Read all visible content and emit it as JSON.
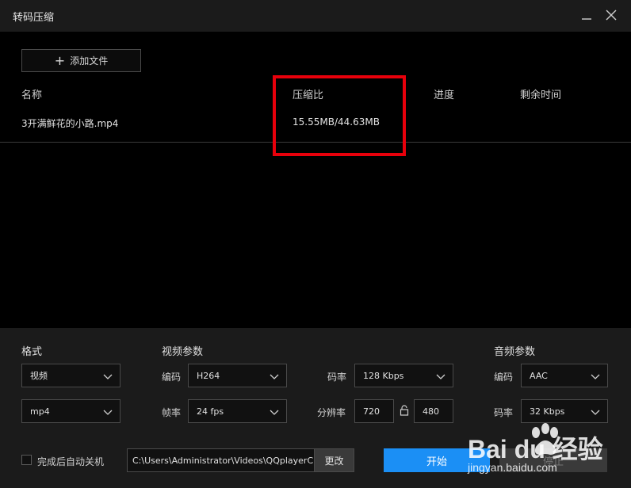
{
  "window": {
    "title": "转码压缩"
  },
  "toolbar": {
    "add_file_label": "添加文件"
  },
  "file_table": {
    "columns": [
      "名称",
      "压缩比",
      "进度",
      "剩余时间"
    ],
    "rows": [
      {
        "name": "3开满鲜花的小路.mp4",
        "ratio": "15.55MB/44.63MB",
        "progress": "",
        "remaining": ""
      }
    ]
  },
  "annotation": {
    "highlight_color": "#e8000b"
  },
  "settings": {
    "format": {
      "title": "格式",
      "type_value": "视频",
      "container_value": "mp4"
    },
    "video": {
      "title": "视频参数",
      "codec_label": "编码",
      "codec_value": "H264",
      "fps_label": "帧率",
      "fps_value": "24 fps",
      "bitrate_label": "码率",
      "bitrate_value": "128 Kbps",
      "resolution_label": "分辨率",
      "width_value": "720",
      "height_value": "480"
    },
    "audio": {
      "title": "音频参数",
      "codec_label": "编码",
      "codec_value": "AAC",
      "bitrate_label": "码率",
      "bitrate_value": "32 Kbps"
    }
  },
  "footer": {
    "auto_shutdown_label": "完成后自动关机",
    "auto_shutdown_checked": false,
    "output_path": "C:\\Users\\Administrator\\Videos\\QQplayerC",
    "change_label": "更改",
    "start_label": "开始",
    "stop_label": "停止"
  },
  "theme": {
    "accent": "#1b8ff5",
    "panel_bg": "#1b1b1b",
    "list_bg": "#000000"
  },
  "watermark": {
    "brand": "Bai du 经验",
    "url": "jingyan.baidu.com"
  }
}
